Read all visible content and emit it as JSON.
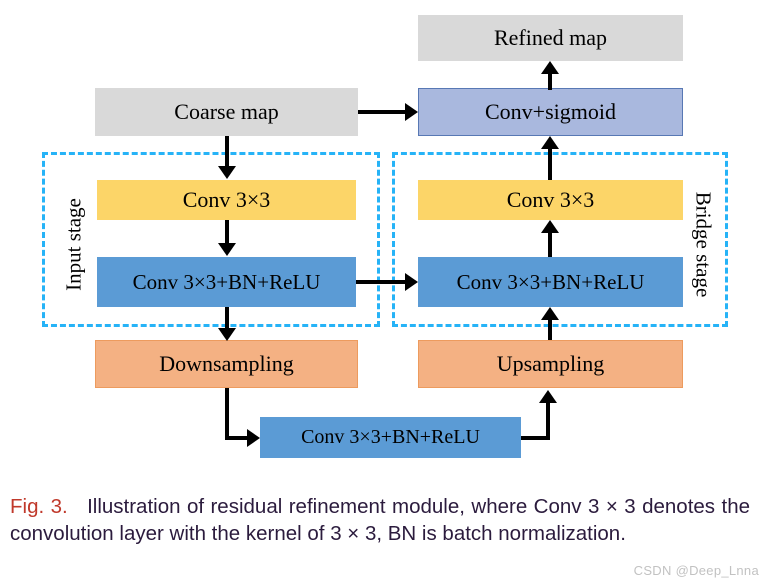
{
  "figure": {
    "nodes": {
      "refined_map": "Refined map",
      "coarse_map": "Coarse map",
      "conv_sigmoid": "Conv+sigmoid",
      "conv3x3_left": "Conv 3×3",
      "conv3x3_right": "Conv 3×3",
      "conv_bn_relu_left": "Conv 3×3+BN+ReLU",
      "conv_bn_relu_right": "Conv 3×3+BN+ReLU",
      "conv_bn_relu_bottom": "Conv 3×3+BN+ReLU",
      "downsampling": "Downsampling",
      "upsampling": "Upsampling"
    },
    "stages": {
      "input_stage": "Input stage",
      "bridge_stage": "Bridge stage"
    },
    "colors": {
      "gray": "#d9d9d9",
      "blue": "#5b9bd5",
      "yellow": "#fcd568",
      "orange": "#f4b183",
      "periwinkle": "#a9b8de",
      "dashed_border": "#26b3f7",
      "arrow": "#000000",
      "caption_figno": "#c0392b",
      "caption_text": "#2b1b3d"
    }
  },
  "caption": {
    "fig_number": "Fig. 3.",
    "text": "Illustration of residual refinement module, where Conv 3 × 3 denotes the convolution layer with the kernel of 3 × 3, BN is batch normalization."
  },
  "watermark": {
    "text": "CSDN @Deep_Lnna"
  }
}
